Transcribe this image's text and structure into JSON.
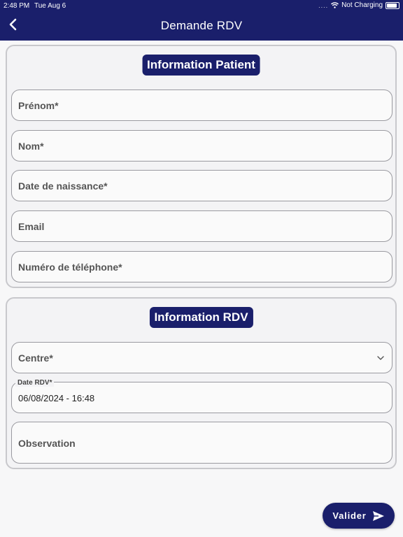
{
  "status_bar": {
    "time": "2:48 PM",
    "date": "Tue Aug 6",
    "dots": "....",
    "charging": "Not Charging"
  },
  "header": {
    "title": "Demande RDV"
  },
  "patient_section": {
    "heading": "Information Patient",
    "fields": {
      "first_name": "Prénom*",
      "last_name": "Nom*",
      "birth_date": "Date de naissance*",
      "email": "Email",
      "phone": "Numéro de téléphone*"
    }
  },
  "rdv_section": {
    "heading": "Information RDV",
    "centre_label": "Centre*",
    "date_label": "Date RDV*",
    "date_value": "06/08/2024 - 16:48",
    "observation_label": "Observation"
  },
  "actions": {
    "submit_label": "Valider"
  },
  "colors": {
    "primary": "#1a1f6b",
    "background": "#f7f7f8"
  }
}
